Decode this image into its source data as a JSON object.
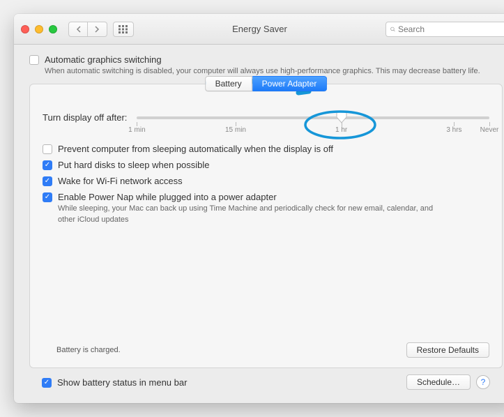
{
  "window": {
    "title": "Energy Saver"
  },
  "search": {
    "placeholder": "Search"
  },
  "autographics": {
    "label": "Automatic graphics switching",
    "checked": false,
    "description": "When automatic switching is disabled, your computer will always use high-performance graphics. This may decrease battery life."
  },
  "tabs": {
    "battery": "Battery",
    "power": "Power Adapter",
    "active": "power"
  },
  "slider": {
    "label": "Turn display off after:",
    "marks": {
      "min": "1 min",
      "fifteen": "15 min",
      "hour": "1 hr",
      "three": "3 hrs",
      "never": "Never"
    },
    "value_pct": 58
  },
  "options": {
    "prevent_sleep": {
      "label": "Prevent computer from sleeping automatically when the display is off",
      "checked": false
    },
    "hard_disks": {
      "label": "Put hard disks to sleep when possible",
      "checked": true
    },
    "wifi": {
      "label": "Wake for Wi-Fi network access",
      "checked": true
    },
    "power_nap": {
      "label": "Enable Power Nap while plugged into a power adapter",
      "checked": true,
      "sub": "While sleeping, your Mac can back up using Time Machine and periodically check for new email, calendar, and other iCloud updates"
    }
  },
  "status": "Battery is charged.",
  "buttons": {
    "restore": "Restore Defaults",
    "schedule": "Schedule…"
  },
  "menubar": {
    "label": "Show battery status in menu bar",
    "checked": true
  }
}
